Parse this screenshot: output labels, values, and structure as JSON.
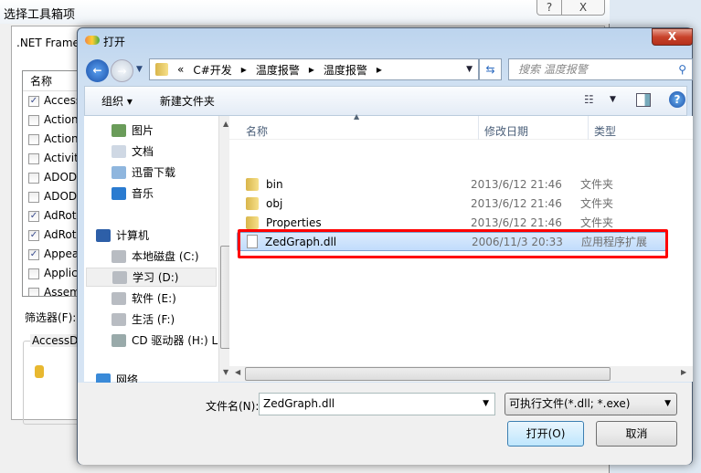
{
  "background_window": {
    "title": "选择工具箱项",
    "help_label": "?",
    "close_label": "X",
    "tab_label": ".NET Frame",
    "list_header": "名称",
    "items": [
      {
        "label": "Access",
        "checked": true
      },
      {
        "label": "Action",
        "checked": false
      },
      {
        "label": "Action",
        "checked": false
      },
      {
        "label": "Activity",
        "checked": false
      },
      {
        "label": "ADOD",
        "checked": false
      },
      {
        "label": "ADOD",
        "checked": false
      },
      {
        "label": "AdRot",
        "checked": true
      },
      {
        "label": "AdRot",
        "checked": true
      },
      {
        "label": "Appea",
        "checked": true
      },
      {
        "label": "Applic",
        "checked": false
      },
      {
        "label": "Assem",
        "checked": false
      }
    ],
    "filter_label": "筛选器(F):",
    "group_label": "AccessDa"
  },
  "dialog": {
    "title": "打开",
    "close_label": "X",
    "breadcrumb": [
      "«",
      "C#开发",
      "温度报警",
      "温度报警"
    ],
    "search_placeholder": "搜索 温度报警",
    "toolbar": {
      "organize": "组织 ▾",
      "new_folder": "新建文件夹"
    },
    "nav": [
      {
        "label": "图片",
        "icon": "pictures-icon"
      },
      {
        "label": "文档",
        "icon": "documents-icon"
      },
      {
        "label": "迅雷下载",
        "icon": "download-icon"
      },
      {
        "label": "音乐",
        "icon": "music-icon"
      },
      {
        "label": "计算机",
        "icon": "computer-icon"
      },
      {
        "label": "本地磁盘 (C:)",
        "icon": "drive-icon"
      },
      {
        "label": "学习 (D:)",
        "icon": "drive-icon",
        "selected": true
      },
      {
        "label": "软件 (E:)",
        "icon": "drive-icon"
      },
      {
        "label": "生活 (F:)",
        "icon": "drive-icon"
      },
      {
        "label": "CD 驱动器 (H:) L",
        "icon": "cd-drive-icon"
      },
      {
        "label": "网络",
        "icon": "network-icon"
      }
    ],
    "columns": {
      "name": "名称",
      "date": "修改日期",
      "type": "类型"
    },
    "files": [
      {
        "name": "bin",
        "date": "2013/6/12 21:46",
        "type": "文件夹"
      },
      {
        "name": "obj",
        "date": "2013/6/12 21:46",
        "type": "文件夹"
      },
      {
        "name": "Properties",
        "date": "2013/6/12 21:46",
        "type": "文件夹"
      },
      {
        "name": "ZedGraph.dll",
        "date": "2006/11/3 20:33",
        "type": "应用程序扩展",
        "selected": true
      }
    ],
    "filename_label": "文件名(N):",
    "filename_value": "ZedGraph.dll",
    "filetype_value": "可执行文件(*.dll; *.exe)",
    "open_label": "打开(O)",
    "cancel_label": "取消",
    "highlight_color": "#ff0000"
  }
}
